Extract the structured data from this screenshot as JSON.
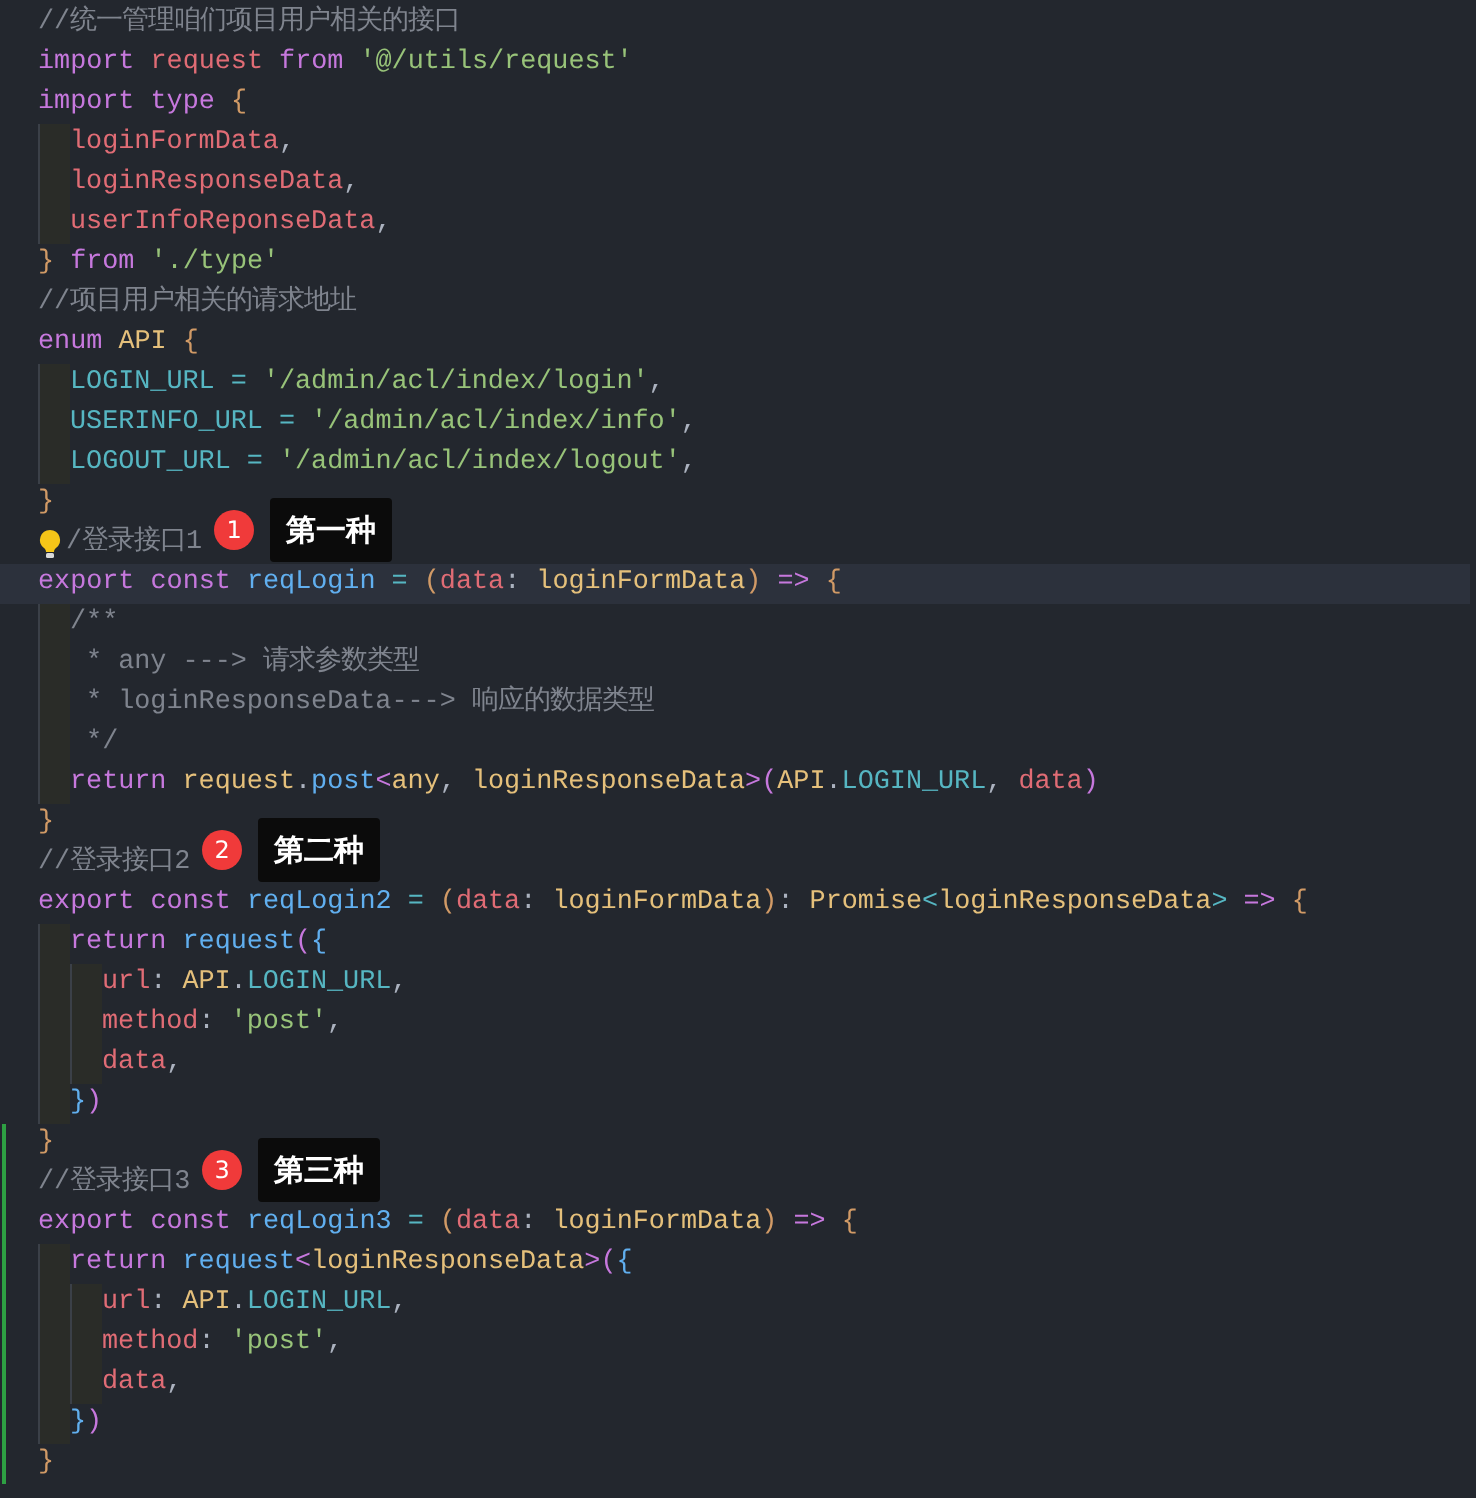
{
  "editor": {
    "lines": [
      {
        "tokens": [
          {
            "kind": "comment",
            "text": "//统一管理咱们项目用户相关的接口"
          }
        ]
      },
      {
        "tokens": [
          {
            "kind": "keyword",
            "text": "import "
          },
          {
            "kind": "variable",
            "text": "request "
          },
          {
            "kind": "keyword",
            "text": "from "
          },
          {
            "kind": "string",
            "text": "'@/utils/request'"
          }
        ]
      },
      {
        "tokens": [
          {
            "kind": "keyword",
            "text": "import type "
          },
          {
            "kind": "bracket1",
            "text": "{"
          }
        ]
      },
      {
        "tokens": [
          {
            "kind": "variable",
            "text": "  loginFormData"
          },
          {
            "kind": "plain",
            "text": ","
          }
        ]
      },
      {
        "tokens": [
          {
            "kind": "variable",
            "text": "  loginResponseData"
          },
          {
            "kind": "plain",
            "text": ","
          }
        ]
      },
      {
        "tokens": [
          {
            "kind": "variable",
            "text": "  userInfoReponseData"
          },
          {
            "kind": "plain",
            "text": ","
          }
        ]
      },
      {
        "tokens": [
          {
            "kind": "bracket1",
            "text": "} "
          },
          {
            "kind": "keyword",
            "text": "from "
          },
          {
            "kind": "string",
            "text": "'./type'"
          }
        ]
      },
      {
        "tokens": [
          {
            "kind": "comment",
            "text": "//项目用户相关的请求地址"
          }
        ]
      },
      {
        "tokens": [
          {
            "kind": "keyword",
            "text": "enum "
          },
          {
            "kind": "type",
            "text": "API "
          },
          {
            "kind": "bracket1",
            "text": "{"
          }
        ]
      },
      {
        "tokens": [
          {
            "kind": "constant",
            "text": "  LOGIN_URL "
          },
          {
            "kind": "operator",
            "text": "= "
          },
          {
            "kind": "string",
            "text": "'/admin/acl/index/login'"
          },
          {
            "kind": "plain",
            "text": ","
          }
        ]
      },
      {
        "tokens": [
          {
            "kind": "constant",
            "text": "  USERINFO_URL "
          },
          {
            "kind": "operator",
            "text": "= "
          },
          {
            "kind": "string",
            "text": "'/admin/acl/index/info'"
          },
          {
            "kind": "plain",
            "text": ","
          }
        ]
      },
      {
        "tokens": [
          {
            "kind": "constant",
            "text": "  LOGOUT_URL "
          },
          {
            "kind": "operator",
            "text": "= "
          },
          {
            "kind": "string",
            "text": "'/admin/acl/index/logout'"
          },
          {
            "kind": "plain",
            "text": ","
          }
        ]
      },
      {
        "tokens": [
          {
            "kind": "bracket1",
            "text": "}"
          }
        ]
      },
      {
        "lightbulb": true,
        "tokens": [
          {
            "kind": "comment",
            "text": "/登录接口1"
          }
        ],
        "note": {
          "number": "1",
          "label": "第一种"
        }
      },
      {
        "current": true,
        "tokens": [
          {
            "kind": "keyword",
            "text": "export const "
          },
          {
            "kind": "function",
            "text": "reqLogin "
          },
          {
            "kind": "operator",
            "text": "= "
          },
          {
            "kind": "bracket1",
            "text": "("
          },
          {
            "kind": "variable",
            "text": "data"
          },
          {
            "kind": "plain",
            "text": ": "
          },
          {
            "kind": "type",
            "text": "loginFormData"
          },
          {
            "kind": "bracket1",
            "text": ") "
          },
          {
            "kind": "keyword",
            "text": "=> "
          },
          {
            "kind": "bracket1",
            "text": "{"
          }
        ]
      },
      {
        "tokens": [
          {
            "kind": "comment",
            "text": "  /**"
          }
        ]
      },
      {
        "tokens": [
          {
            "kind": "comment",
            "text": "   * any ---> 请求参数类型"
          }
        ]
      },
      {
        "tokens": [
          {
            "kind": "comment",
            "text": "   * loginResponseData---> 响应的数据类型"
          }
        ]
      },
      {
        "tokens": [
          {
            "kind": "comment",
            "text": "   */"
          }
        ]
      },
      {
        "tokens": [
          {
            "kind": "keyword",
            "text": "  return "
          },
          {
            "kind": "type",
            "text": "request"
          },
          {
            "kind": "plain",
            "text": "."
          },
          {
            "kind": "function",
            "text": "post"
          },
          {
            "kind": "bracket2",
            "text": "<"
          },
          {
            "kind": "type",
            "text": "any"
          },
          {
            "kind": "plain",
            "text": ", "
          },
          {
            "kind": "type",
            "text": "loginResponseData"
          },
          {
            "kind": "bracket2",
            "text": ">"
          },
          {
            "kind": "bracket2",
            "text": "("
          },
          {
            "kind": "type",
            "text": "API"
          },
          {
            "kind": "plain",
            "text": "."
          },
          {
            "kind": "constant",
            "text": "LOGIN_URL"
          },
          {
            "kind": "plain",
            "text": ", "
          },
          {
            "kind": "variable",
            "text": "data"
          },
          {
            "kind": "bracket2",
            "text": ")"
          }
        ]
      },
      {
        "tokens": [
          {
            "kind": "bracket1",
            "text": "}"
          }
        ]
      },
      {
        "tokens": [
          {
            "kind": "comment",
            "text": "//登录接口2"
          }
        ],
        "note": {
          "number": "2",
          "label": "第二种"
        }
      },
      {
        "tokens": [
          {
            "kind": "keyword",
            "text": "export const "
          },
          {
            "kind": "function",
            "text": "reqLogin2 "
          },
          {
            "kind": "operator",
            "text": "= "
          },
          {
            "kind": "bracket1",
            "text": "("
          },
          {
            "kind": "variable",
            "text": "data"
          },
          {
            "kind": "plain",
            "text": ": "
          },
          {
            "kind": "type",
            "text": "loginFormData"
          },
          {
            "kind": "bracket1",
            "text": ")"
          },
          {
            "kind": "plain",
            "text": ": "
          },
          {
            "kind": "type",
            "text": "Promise"
          },
          {
            "kind": "operator",
            "text": "<"
          },
          {
            "kind": "type",
            "text": "loginResponseData"
          },
          {
            "kind": "operator",
            "text": "> "
          },
          {
            "kind": "keyword",
            "text": "=> "
          },
          {
            "kind": "bracket1",
            "text": "{"
          }
        ]
      },
      {
        "tokens": [
          {
            "kind": "keyword",
            "text": "  return "
          },
          {
            "kind": "function",
            "text": "request"
          },
          {
            "kind": "bracket2",
            "text": "("
          },
          {
            "kind": "bracket3",
            "text": "{"
          }
        ]
      },
      {
        "tokens": [
          {
            "kind": "variable",
            "text": "    url"
          },
          {
            "kind": "plain",
            "text": ": "
          },
          {
            "kind": "type",
            "text": "API"
          },
          {
            "kind": "plain",
            "text": "."
          },
          {
            "kind": "constant",
            "text": "LOGIN_URL"
          },
          {
            "kind": "plain",
            "text": ","
          }
        ]
      },
      {
        "tokens": [
          {
            "kind": "variable",
            "text": "    method"
          },
          {
            "kind": "plain",
            "text": ": "
          },
          {
            "kind": "string",
            "text": "'post'"
          },
          {
            "kind": "plain",
            "text": ","
          }
        ]
      },
      {
        "tokens": [
          {
            "kind": "variable",
            "text": "    data"
          },
          {
            "kind": "plain",
            "text": ","
          }
        ]
      },
      {
        "tokens": [
          {
            "kind": "bracket3",
            "text": "  }"
          },
          {
            "kind": "bracket2",
            "text": ")"
          }
        ]
      },
      {
        "changed": true,
        "tokens": [
          {
            "kind": "bracket1",
            "text": "}"
          }
        ]
      },
      {
        "changed": true,
        "tokens": [
          {
            "kind": "comment",
            "text": "//登录接口3"
          }
        ],
        "note": {
          "number": "3",
          "label": "第三种"
        }
      },
      {
        "changed": true,
        "tokens": [
          {
            "kind": "keyword",
            "text": "export const "
          },
          {
            "kind": "function",
            "text": "reqLogin3 "
          },
          {
            "kind": "operator",
            "text": "= "
          },
          {
            "kind": "bracket1",
            "text": "("
          },
          {
            "kind": "variable",
            "text": "data"
          },
          {
            "kind": "plain",
            "text": ": "
          },
          {
            "kind": "type",
            "text": "loginFormData"
          },
          {
            "kind": "bracket1",
            "text": ") "
          },
          {
            "kind": "keyword",
            "text": "=> "
          },
          {
            "kind": "bracket1",
            "text": "{"
          }
        ]
      },
      {
        "changed": true,
        "tokens": [
          {
            "kind": "keyword",
            "text": "  return "
          },
          {
            "kind": "function",
            "text": "request"
          },
          {
            "kind": "keyword",
            "text": "<"
          },
          {
            "kind": "type",
            "text": "loginResponseData"
          },
          {
            "kind": "keyword",
            "text": ">"
          },
          {
            "kind": "bracket2",
            "text": "("
          },
          {
            "kind": "bracket3",
            "text": "{"
          }
        ]
      },
      {
        "changed": true,
        "tokens": [
          {
            "kind": "variable",
            "text": "    url"
          },
          {
            "kind": "plain",
            "text": ": "
          },
          {
            "kind": "type",
            "text": "API"
          },
          {
            "kind": "plain",
            "text": "."
          },
          {
            "kind": "constant",
            "text": "LOGIN_URL"
          },
          {
            "kind": "plain",
            "text": ","
          }
        ]
      },
      {
        "changed": true,
        "tokens": [
          {
            "kind": "variable",
            "text": "    method"
          },
          {
            "kind": "plain",
            "text": ": "
          },
          {
            "kind": "string",
            "text": "'post'"
          },
          {
            "kind": "plain",
            "text": ","
          }
        ]
      },
      {
        "changed": true,
        "tokens": [
          {
            "kind": "variable",
            "text": "    data"
          },
          {
            "kind": "plain",
            "text": ","
          }
        ]
      },
      {
        "changed": true,
        "tokens": [
          {
            "kind": "bracket3",
            "text": "  }"
          },
          {
            "kind": "bracket2",
            "text": ")"
          }
        ]
      },
      {
        "changed": true,
        "tokens": [
          {
            "kind": "bracket1",
            "text": "}"
          }
        ]
      }
    ]
  }
}
